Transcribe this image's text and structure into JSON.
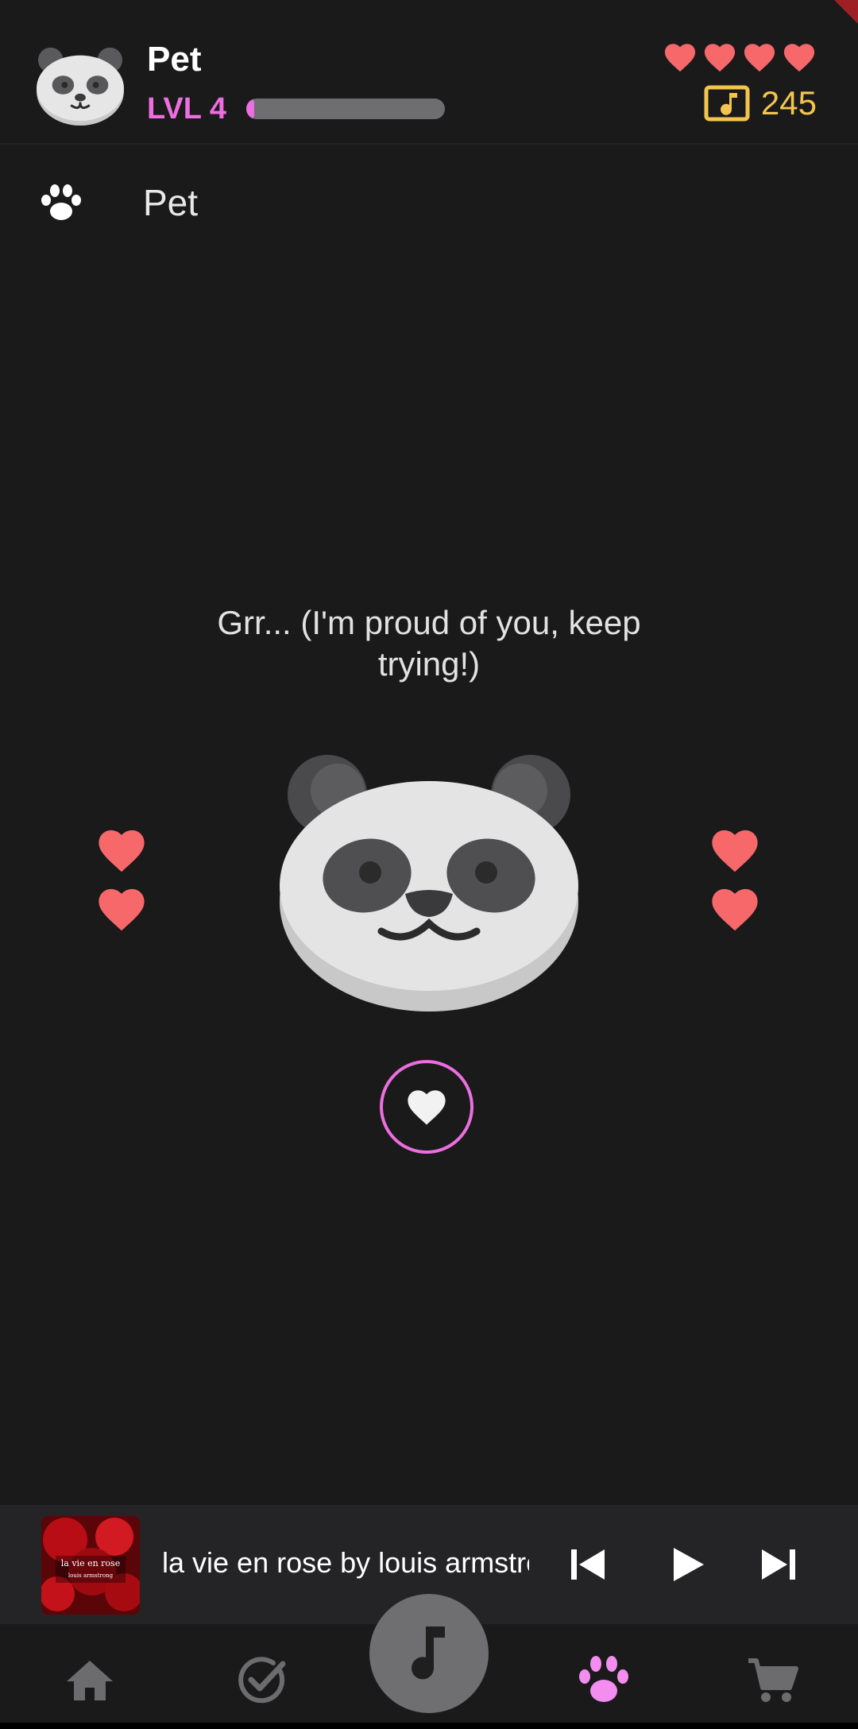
{
  "header": {
    "pet_name": "Pet",
    "level_label": "LVL 4",
    "xp_progress_percent": 4,
    "lives": 4,
    "coins": "245"
  },
  "section": {
    "title": "Pet",
    "icon": "paw-icon"
  },
  "pet": {
    "speech": "Grr... (I'm proud of you, keep trying!)",
    "side_hearts_each_side": 2
  },
  "player": {
    "track_title": "la vie en rose by louis armstrong",
    "album_art_title": "la vie en rose",
    "album_art_artist": "louis armstrong"
  },
  "nav": {
    "items": [
      "home-icon",
      "tasks-icon",
      "music-icon",
      "pet-icon",
      "cart-icon"
    ],
    "active": "pet-icon"
  },
  "colors": {
    "accent": "#ec6ee0",
    "heart": "#f6686a",
    "coin": "#f4c54e",
    "background": "#1a1a1b"
  }
}
